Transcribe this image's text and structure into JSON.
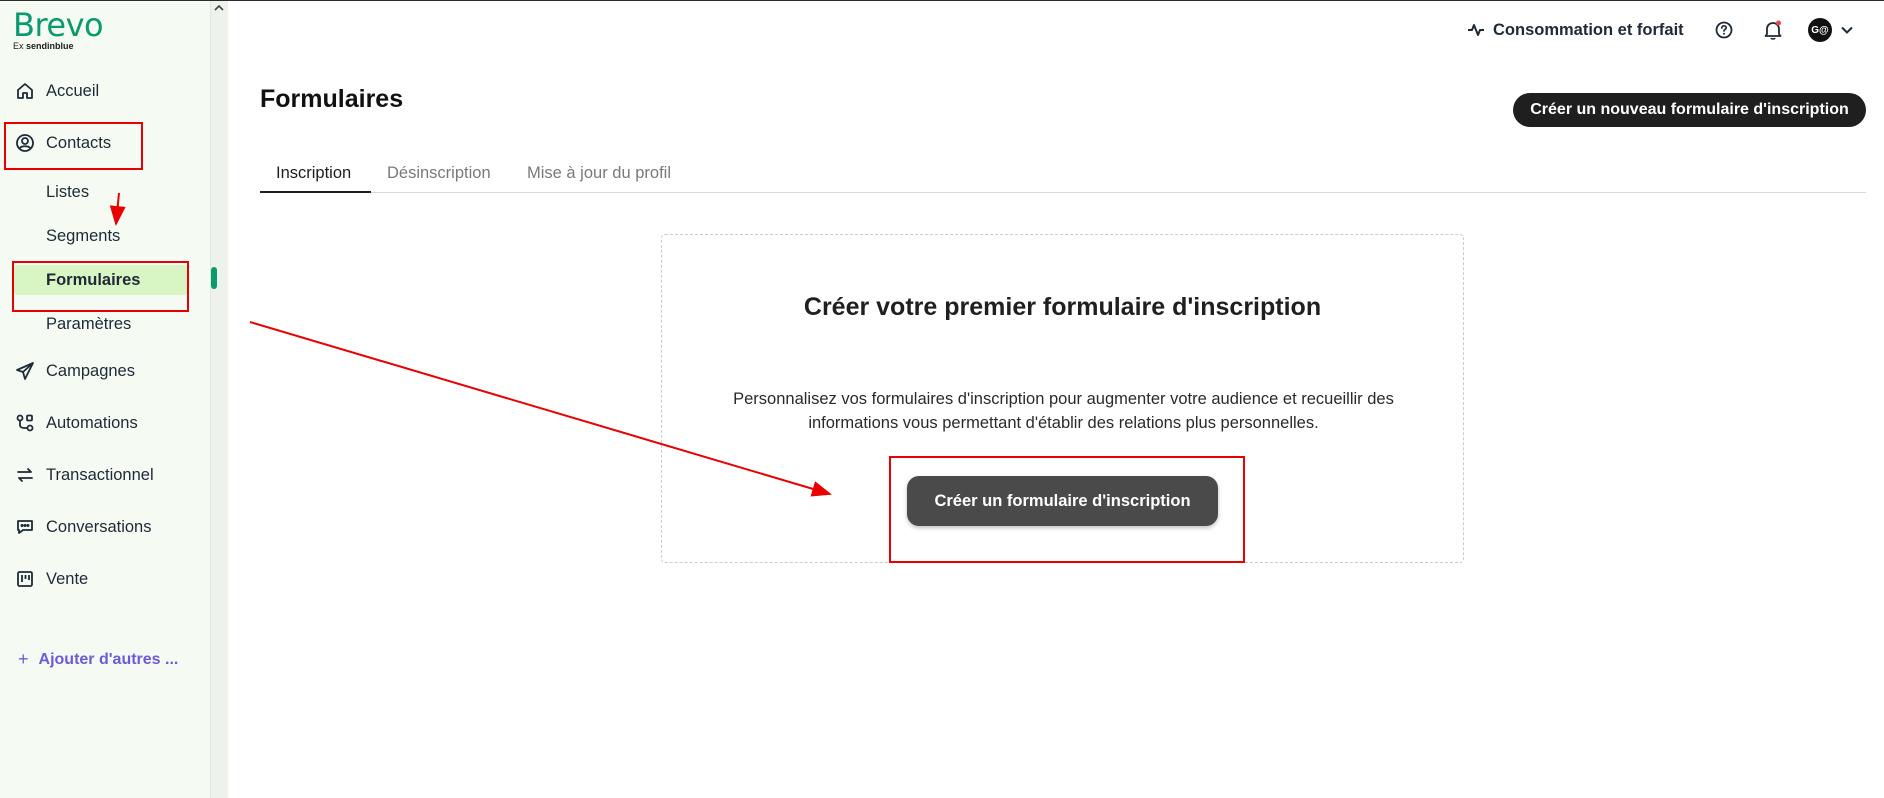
{
  "brand": {
    "name": "Brevo",
    "sub_prefix": "Ex",
    "sub_brand": "sendinblue"
  },
  "sidebar": {
    "items": [
      {
        "label": "Accueil",
        "icon": "home-icon"
      },
      {
        "label": "Contacts",
        "icon": "user-circle-icon"
      },
      {
        "label": "Campagnes",
        "icon": "send-icon"
      },
      {
        "label": "Automations",
        "icon": "automation-icon"
      },
      {
        "label": "Transactionnel",
        "icon": "arrows-swap-icon"
      },
      {
        "label": "Conversations",
        "icon": "chat-icon"
      },
      {
        "label": "Vente",
        "icon": "kanban-icon"
      }
    ],
    "contacts_sub": [
      "Listes",
      "Segments",
      "Formulaires",
      "Paramètres"
    ],
    "active_sub": "Formulaires",
    "add_more": "Ajouter d'autres ..."
  },
  "header": {
    "usage_label": "Consommation et forfait",
    "avatar_initials": "G@"
  },
  "main": {
    "title": "Formulaires",
    "new_form_button": "Créer un nouveau formulaire d'inscription",
    "tabs": [
      "Inscription",
      "Désinscription",
      "Mise à jour du profil"
    ],
    "active_tab": "Inscription",
    "empty_state": {
      "title": "Créer votre premier formulaire d'inscription",
      "description": "Personnalisez vos formulaires d'inscription pour augmenter votre audience et recueillir des informations vous permettant d'établir des relations plus personnelles.",
      "button": "Créer un formulaire d'inscription"
    }
  },
  "colors": {
    "brand_green": "#0b996e",
    "active_item_bg": "#d8f5c4",
    "annotation_red": "#e80000",
    "add_more_purple": "#6e5ad9"
  }
}
